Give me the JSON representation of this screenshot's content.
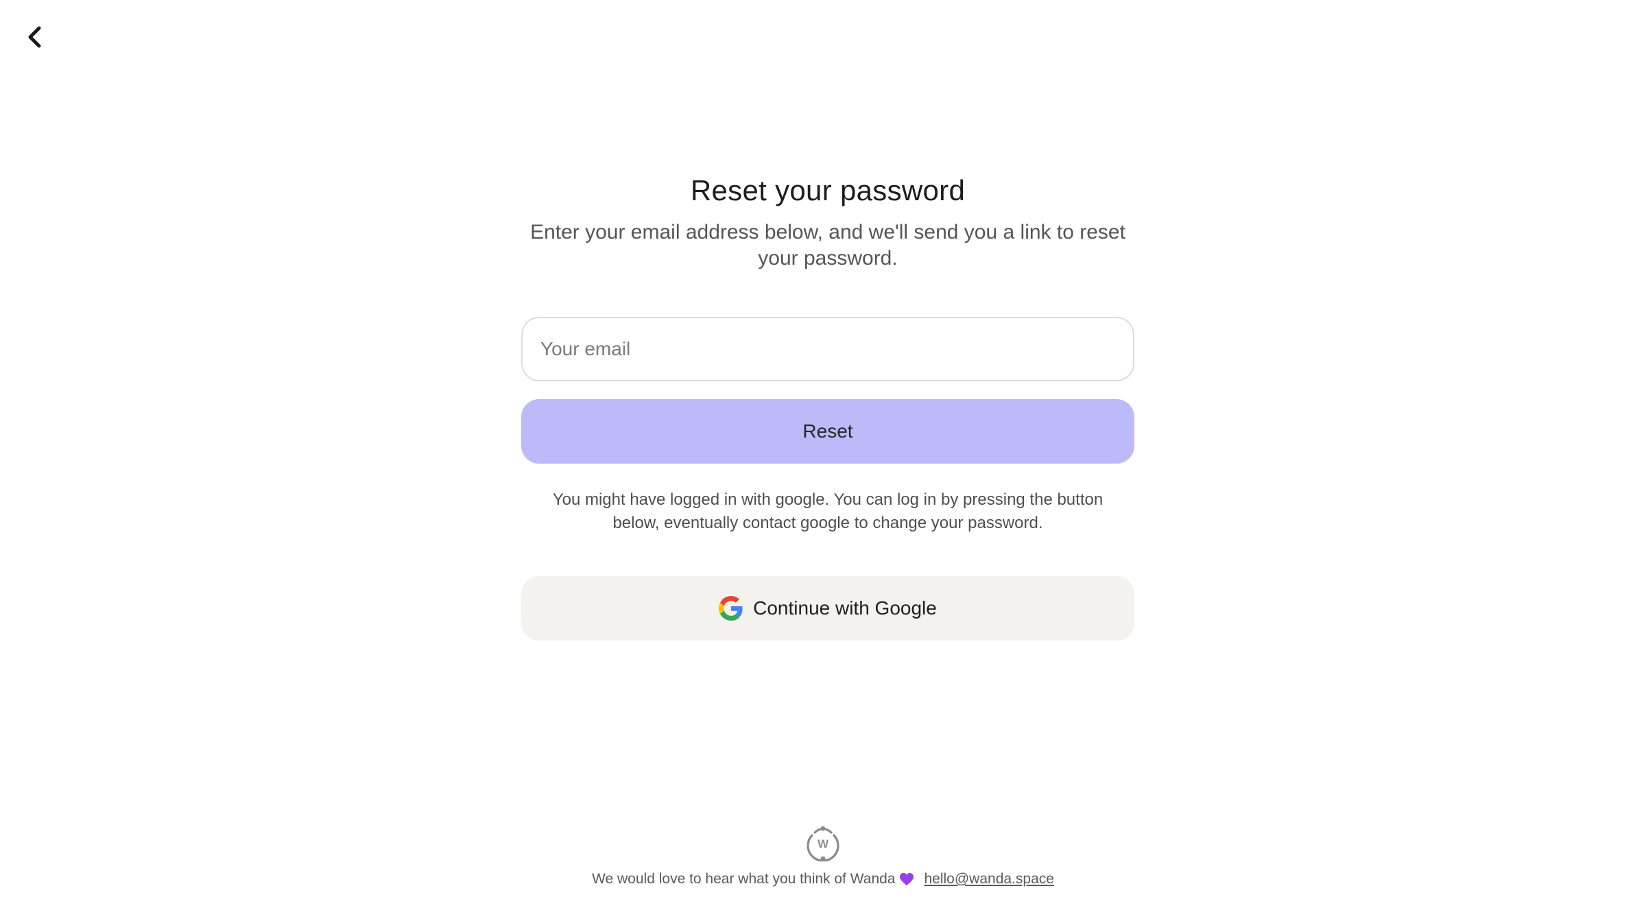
{
  "nav": {
    "back_icon": "chevron-left-icon"
  },
  "form": {
    "title": "Reset your password",
    "subtitle": "Enter your email address below, and we'll send you a link to reset your password.",
    "email_placeholder": "Your email",
    "email_value": "",
    "reset_label": "Reset",
    "google_note": "You might have logged in with google. You can log in by pressing the button below, eventually contact google to change your password.",
    "google_label": "Continue with Google",
    "google_icon": "google-icon"
  },
  "footer": {
    "logo_icon": "wanda-logo-icon",
    "logo_letter": "W",
    "message": "We would love to hear what you think of Wanda",
    "heart_icon": "purple-heart-icon",
    "email_link": "hello@wanda.space"
  },
  "colors": {
    "accent": "#bcbaf8",
    "google_button_bg": "#f4f2ee",
    "heart": "#9b3fe8"
  }
}
